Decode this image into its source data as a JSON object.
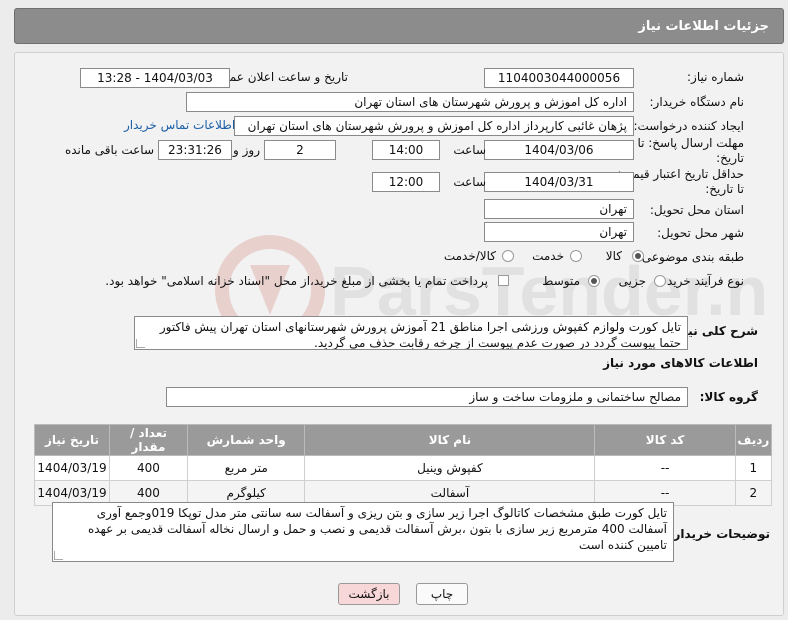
{
  "header": {
    "title": "جزئیات اطلاعات نیاز"
  },
  "fields": {
    "need_number_label": "شماره نیاز:",
    "need_number": "1104003044000056",
    "announce_label": "تاریخ و ساعت اعلان عمومی:",
    "announce_value": "1404/03/03 - 13:28",
    "buyer_label": "نام دستگاه خریدار:",
    "buyer_value": "اداره کل اموزش و پرورش شهرستان های استان تهران",
    "creator_label": "ایجاد کننده درخواست:",
    "creator_value": "پژهان غائبی کارپرداز اداره کل اموزش و پرورش شهرستان های استان تهران",
    "contact_link": "اطلاعات تماس خریدار",
    "deadline_label": "مهلت ارسال پاسخ: تا تاریخ:",
    "deadline_date": "1404/03/06",
    "time_label": "ساعت",
    "deadline_time": "14:00",
    "days_value": "2",
    "days_label": "روز و",
    "remaining_value": "23:31:26",
    "remaining_label": "ساعت باقی مانده",
    "validity_label": "حداقل تاریخ اعتبار قیمت: تا تاریخ:",
    "validity_date": "1404/03/31",
    "validity_time": "12:00",
    "province_label": "استان محل تحویل:",
    "province_value": "تهران",
    "city_label": "شهر محل تحویل:",
    "city_value": "تهران",
    "category_label": "طبقه بندی موضوعی:",
    "category_options": [
      "کالا",
      "خدمت",
      "کالا/خدمت"
    ],
    "process_label": "نوع فرآیند خرید :",
    "process_options": [
      "جزیی",
      "متوسط"
    ],
    "payment_note": "پرداخت تمام یا بخشی از مبلغ خرید،از محل \"اسناد خزانه اسلامی\" خواهد بود."
  },
  "description": {
    "label": "شرح کلی نیاز:",
    "text": "تایل کورت ولوازم کفپوش ورزشی اجرا مناطق 21 آموزش پرورش شهرستانهای استان تهران پیش فاکتور حتما پیوست گردد در صورت عدم پیوست از چرخه رقابت حذف می گردید."
  },
  "goods": {
    "section_title": "اطلاعات کالاهای مورد نیاز",
    "group_label": "گروه کالا:",
    "group_value": "مصالح ساختمانی و ملزومات ساخت و ساز",
    "columns": [
      "ردیف",
      "کد کالا",
      "نام کالا",
      "واحد شمارش",
      "تعداد / مقدار",
      "تاریخ نیاز"
    ],
    "rows": [
      {
        "row": "1",
        "code": "--",
        "name": "کفپوش وینیل",
        "unit": "متر مربع",
        "qty": "400",
        "date": "1404/03/19"
      },
      {
        "row": "2",
        "code": "--",
        "name": "آسفالت",
        "unit": "کیلوگرم",
        "qty": "400",
        "date": "1404/03/19"
      }
    ]
  },
  "buyer_notes": {
    "label": "توضیحات خریدار:",
    "text": "تایل کورت طبق مشخصات کاتالوگ اجرا زیر سازی و بتن ریزی و آسفالت سه سانتی متر مدل توپکا 019وجمع آوری آسفالت 400 مترمربع زیر سازی با بتون ،برش آسفالت قدیمی و نصب و حمل و ارسال نخاله آسفالت قدیمی بر عهده تامیین کننده است"
  },
  "buttons": {
    "print": "چاپ",
    "back": "بازگشت"
  },
  "colors": {
    "header_bg": "#8c8c8c",
    "table_head_bg": "#9a9a9a",
    "link": "#1b5fa8",
    "back_btn_bg": "#f7d7d7"
  },
  "watermark_text": "ParsTender.net"
}
